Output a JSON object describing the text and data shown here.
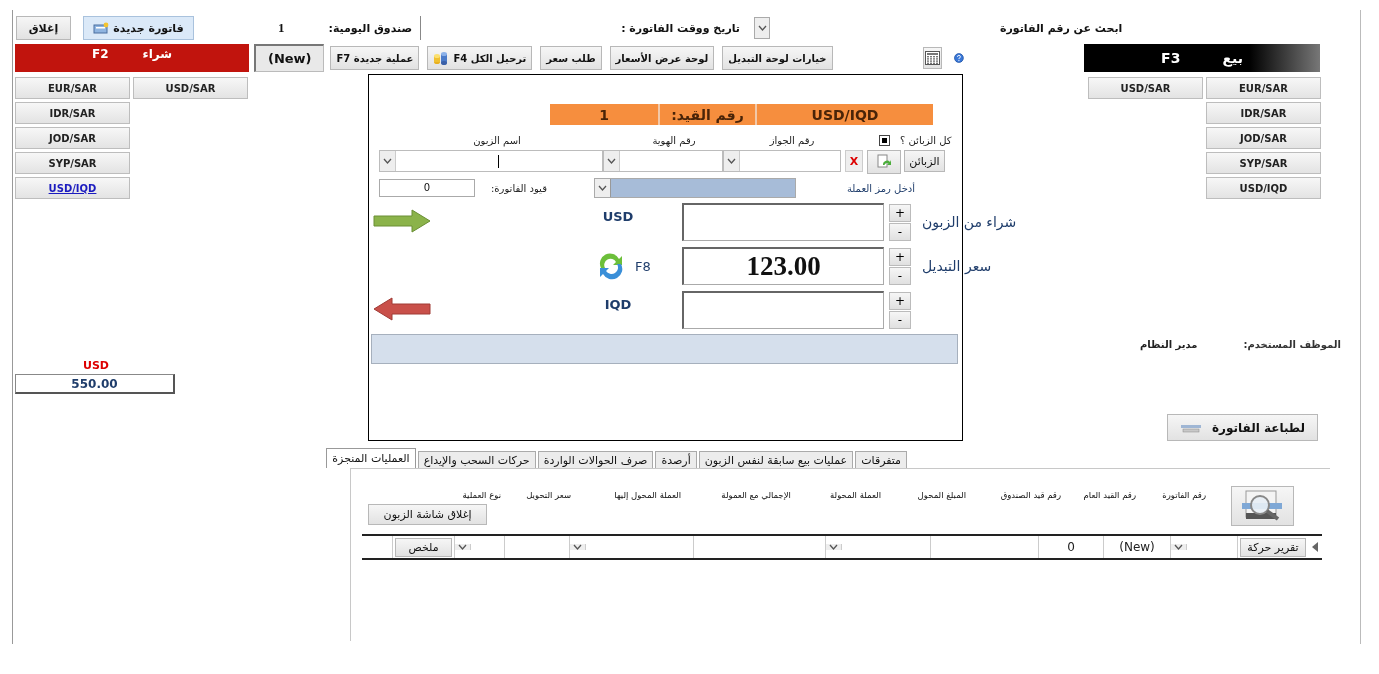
{
  "toolbar": {
    "close_button": "إغلاق",
    "new_invoice_button": "فاتورة جديدة",
    "daily_box": {
      "value": "1",
      "label": "صندوق اليومية:"
    },
    "invoice_datetime": {
      "label": "تاريخ ووقت الفاتورة :"
    },
    "search": {
      "label": "ابحث عن رقم الفاتورة"
    }
  },
  "buy_panel": {
    "title": "شراء",
    "shortcut": "F2",
    "pairs": [
      {
        "label": "USD/SAR",
        "selected": false
      },
      {
        "label": "EUR/SAR",
        "selected": false
      },
      {
        "label": "IDR/SAR",
        "selected": false
      },
      {
        "label": "JOD/SAR",
        "selected": false
      },
      {
        "label": "SYP/SAR",
        "selected": false
      },
      {
        "label": "USD/IQD",
        "selected": true
      }
    ],
    "balance": {
      "currency": "USD",
      "amount": "550.00"
    }
  },
  "record_status": "(New)",
  "actions": [
    {
      "label": "خيارات لوحة التبديل",
      "kind": "plain"
    },
    {
      "label": "لوحة عرض الأسعار",
      "kind": "plain"
    },
    {
      "label": "طلب سعر",
      "kind": "plain"
    },
    {
      "label": "ترحيل الكل F4",
      "kind": "coins"
    },
    {
      "label": "عملية جديدة F7",
      "kind": "plain"
    }
  ],
  "sell_panel": {
    "title": "بيع",
    "shortcut": "F3",
    "pairs": [
      {
        "label": "EUR/SAR",
        "selected": false
      },
      {
        "label": "USD/SAR",
        "selected": false
      },
      {
        "label": "IDR/SAR",
        "selected": false
      },
      {
        "label": "JOD/SAR",
        "selected": false
      },
      {
        "label": "SYP/SAR",
        "selected": false
      },
      {
        "label": "USD/IQD",
        "selected": false
      }
    ]
  },
  "exchange": {
    "header": {
      "pair": "USD/IQD",
      "entry_label": "رقم القيد:",
      "entry_number": "1"
    },
    "all_customers": {
      "label": "كل الزبائن ؟",
      "checked": true
    },
    "field_labels": [
      "رقم الجواز",
      "رقم الهوية",
      "اسم الزبون"
    ],
    "clear_button": "X",
    "customers_button": "الزبائن",
    "invoice_entries": {
      "value": "0",
      "label": "قيود الفاتورة:"
    },
    "currency_code": {
      "label": "أدخل رمز العملة"
    },
    "amount_rows": [
      {
        "kind": "in",
        "currency": "USD",
        "plus": "+",
        "minus": "-",
        "label": "شراء من الزبون"
      },
      {
        "kind": "rate",
        "shortcut": "F8",
        "value": "123.00",
        "plus": "+",
        "minus": "-",
        "label": "سعر التبديل"
      },
      {
        "kind": "out",
        "currency": "IQD",
        "plus": "+",
        "minus": "-"
      }
    ]
  },
  "user": {
    "label": "الموظف المستخدم:",
    "name": "مدير النظام"
  },
  "print_button": "لطباعة الفاتورة",
  "tabs": [
    {
      "label": "متفرقات",
      "selected": false
    },
    {
      "label": "عمليات بيع سابقة لنفس الزبون",
      "selected": false
    },
    {
      "label": "أرصدة",
      "selected": false
    },
    {
      "label": "صرف الحوالات الواردة",
      "selected": false
    },
    {
      "label": "حركات السحب والإيداع",
      "selected": false
    },
    {
      "label": "العمليات المنجزة",
      "selected": true
    }
  ],
  "operations": {
    "columns": [
      "رقم الفاتورة",
      "رقم القيد العام",
      "رقم قيد الصندوق",
      "المبلغ المحول",
      "العملة المحولة",
      "الإجمالي مع العمولة",
      "العملة المحول إليها",
      "سعر التحويل",
      "نوع العملية"
    ],
    "close_customer_button": "إغلاق شاشة الزبون",
    "row": [
      {
        "kind": "button",
        "text": "تقرير حركة"
      },
      {
        "kind": "combo"
      },
      {
        "kind": "text",
        "text": "(New)"
      },
      {
        "kind": "text",
        "text": "0"
      },
      {
        "kind": "text"
      },
      {
        "kind": "combo"
      },
      {
        "kind": "text"
      },
      {
        "kind": "combo"
      },
      {
        "kind": "text"
      },
      {
        "kind": "combo"
      },
      {
        "kind": "button",
        "text": "ملخص"
      }
    ]
  }
}
